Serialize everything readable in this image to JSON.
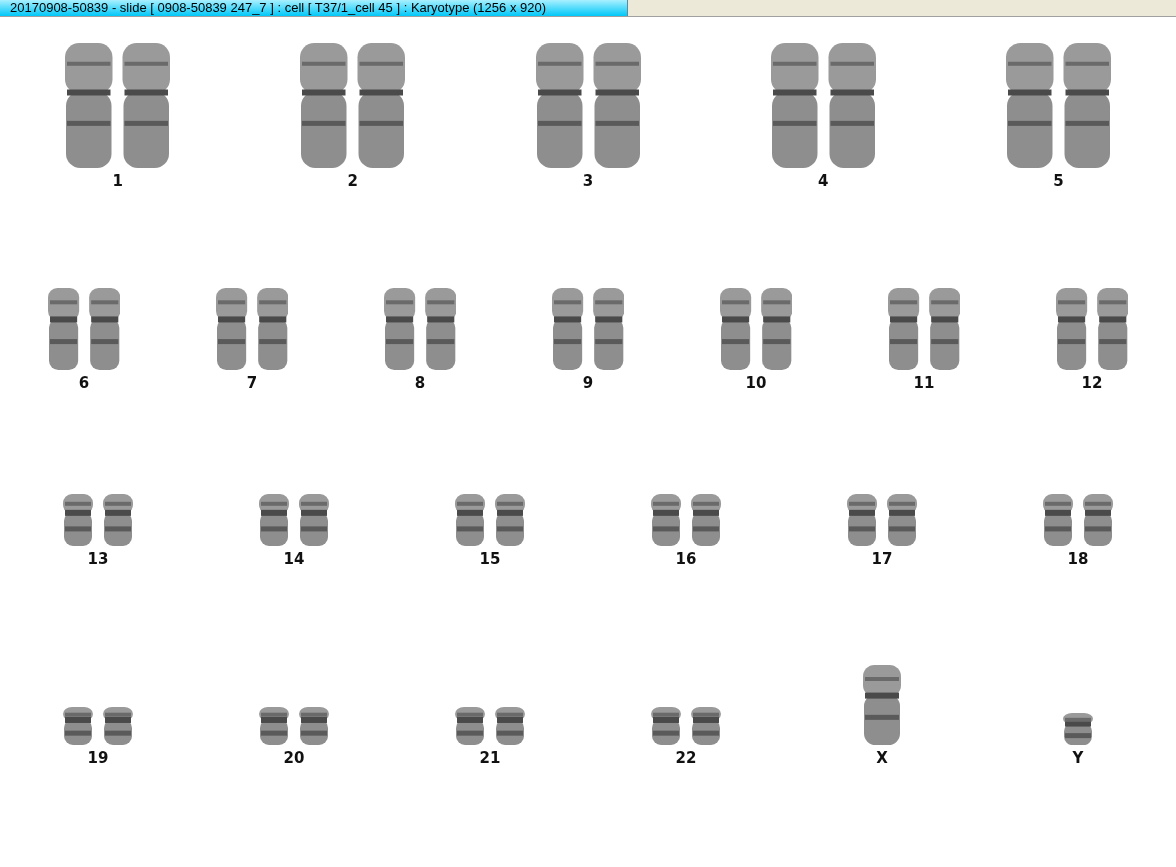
{
  "window": {
    "title": "20170908-50839 - slide [ 0908-50839 247_7 ] : cell [ T37/1_cell 45 ] : Karyotype  (1256 x 920)"
  },
  "karyotype": {
    "rows": [
      {
        "items": [
          {
            "label": "1",
            "kind": "pair"
          },
          {
            "label": "2",
            "kind": "pair"
          },
          {
            "label": "3",
            "kind": "pair"
          },
          {
            "label": "4",
            "kind": "pair"
          },
          {
            "label": "5",
            "kind": "pair"
          }
        ]
      },
      {
        "items": [
          {
            "label": "6",
            "kind": "pair"
          },
          {
            "label": "7",
            "kind": "pair"
          },
          {
            "label": "8",
            "kind": "pair"
          },
          {
            "label": "9",
            "kind": "pair"
          },
          {
            "label": "10",
            "kind": "pair"
          },
          {
            "label": "11",
            "kind": "pair"
          },
          {
            "label": "12",
            "kind": "pair"
          }
        ]
      },
      {
        "items": [
          {
            "label": "13",
            "kind": "pair"
          },
          {
            "label": "14",
            "kind": "pair"
          },
          {
            "label": "15",
            "kind": "pair"
          },
          {
            "label": "16",
            "kind": "pair"
          },
          {
            "label": "17",
            "kind": "pair"
          },
          {
            "label": "18",
            "kind": "pair"
          }
        ]
      },
      {
        "items": [
          {
            "label": "19",
            "kind": "pair"
          },
          {
            "label": "20",
            "kind": "pair"
          },
          {
            "label": "21",
            "kind": "pair"
          },
          {
            "label": "22",
            "kind": "pair"
          },
          {
            "label": "X",
            "kind": "single"
          },
          {
            "label": "Y",
            "kind": "single"
          }
        ]
      }
    ]
  }
}
